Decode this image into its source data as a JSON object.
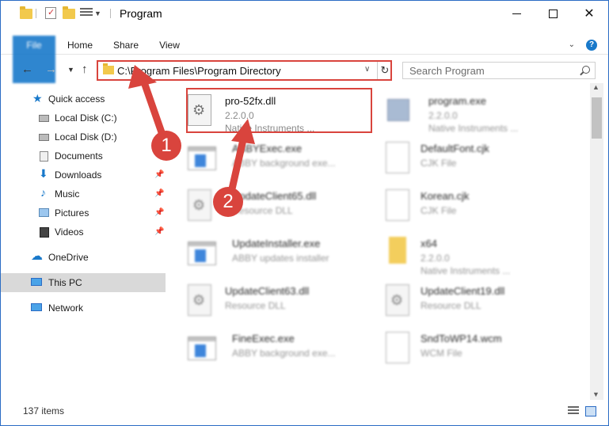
{
  "window": {
    "title": "Program"
  },
  "ribbon": {
    "tabs": [
      "File",
      "Home",
      "Share",
      "View"
    ]
  },
  "navbar": {
    "address": "C:\\Program Files\\Program Directory",
    "search_placeholder": "Search Program"
  },
  "sidebar": {
    "items": [
      {
        "label": "Quick access",
        "icon": "star-icon",
        "pinned": false
      },
      {
        "label": "Local Disk (C:)",
        "icon": "drive-icon",
        "pinned": false
      },
      {
        "label": "Local Disk (D:)",
        "icon": "drive-icon",
        "pinned": false
      },
      {
        "label": "Documents",
        "icon": "documents-icon",
        "pinned": false
      },
      {
        "label": "Downloads",
        "icon": "download-icon",
        "pinned": true
      },
      {
        "label": "Music",
        "icon": "music-icon",
        "pinned": true
      },
      {
        "label": "Pictures",
        "icon": "pictures-icon",
        "pinned": true
      },
      {
        "label": "Videos",
        "icon": "videos-icon",
        "pinned": true
      },
      {
        "label": "OneDrive",
        "icon": "cloud-icon",
        "pinned": false
      },
      {
        "label": "This PC",
        "icon": "pc-icon",
        "pinned": false,
        "selected": true
      },
      {
        "label": "Network",
        "icon": "network-icon",
        "pinned": false
      }
    ]
  },
  "files": [
    {
      "name": "pro-52fx.dll",
      "line1": "2.2.0.0",
      "line2": "Native Instruments ...",
      "icon": "dll-icon"
    },
    {
      "name": "program.exe",
      "line1": "2.2.0.0",
      "line2": "Native Instruments ...",
      "icon": "program-icon"
    },
    {
      "name": "ABBYExec.exe",
      "line1": "ABBY background exe...",
      "line2": "",
      "icon": "exe-icon"
    },
    {
      "name": "DefaultFont.cjk",
      "line1": "CJK File",
      "line2": "",
      "icon": "document-icon"
    },
    {
      "name": "UpdateClient65.dll",
      "line1": "Resource DLL",
      "line2": "",
      "icon": "dll-icon"
    },
    {
      "name": "Korean.cjk",
      "line1": "CJK File",
      "line2": "",
      "icon": "document-icon"
    },
    {
      "name": "UpdateInstaller.exe",
      "line1": "ABBY updates installer",
      "line2": "",
      "icon": "exe-icon"
    },
    {
      "name": "x64",
      "line1": "2.2.0.0",
      "line2": "Native Instruments ...",
      "icon": "folder-icon"
    },
    {
      "name": "UpdateClient63.dll",
      "line1": "Resource DLL",
      "line2": "",
      "icon": "dll-icon"
    },
    {
      "name": "UpdateClient19.dll",
      "line1": "Resource DLL",
      "line2": "",
      "icon": "dll-icon"
    },
    {
      "name": "FineExec.exe",
      "line1": "ABBY background exe...",
      "line2": "",
      "icon": "exe-icon"
    },
    {
      "name": "SndToWP14.wcm",
      "line1": "WCM File",
      "line2": "",
      "icon": "document-icon"
    }
  ],
  "status": {
    "items_count": "137 items"
  },
  "annotations": {
    "step1": "1",
    "step2": "2"
  },
  "colors": {
    "accent": "#1979ca",
    "highlight": "#d9443d"
  }
}
